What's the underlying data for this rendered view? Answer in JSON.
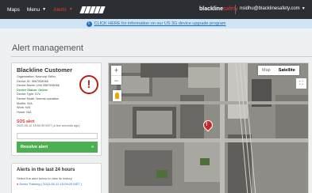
{
  "nav": {
    "maps": "Maps",
    "menu": "Menu",
    "alerts": "Alerts",
    "brand_a": "blackline",
    "brand_b": "safety",
    "user": "nsidhu@blacklinesafety.com"
  },
  "banner": {
    "text": "CLICK HERE for information on our US 3G device upgrade program"
  },
  "page": {
    "title": "Alert management"
  },
  "alert_card": {
    "customer": "Blackline Customer",
    "details": [
      "Organization: Navroop Sidhu",
      "Device ID: 3567008066",
      "Device Name: Unit 3567008066",
      "Device Status: Online",
      "Device Type: G7c",
      "Device Mode: Normal operation",
      "Mobile: N/A",
      "Work: N/A",
      "Home: N/A"
    ],
    "alert_name": "SOS alert",
    "alert_time": "2022-05-12 15:50:39 MST (a few seconds ago)",
    "dropdown_placeholder": "",
    "resolve_label": "Resolve alert",
    "resolve_icon": "double-chevron-right"
  },
  "history": {
    "title": "Alerts in the last 24 hours",
    "hint": "Select the alert below to view its history",
    "item": "Demo Training ( 2022-05-12 15:09:20 MST )",
    "more": "...",
    "item_status_color": "#e53935"
  },
  "map": {
    "type_map": "Map",
    "type_satellite": "Satellite",
    "zoom_in": "+",
    "zoom_out": "−"
  },
  "colors": {
    "nav_bg": "#2b2f33",
    "alert_red": "#e53935",
    "resolve_green": "#4caf50",
    "link_blue": "#1a6fc2"
  }
}
